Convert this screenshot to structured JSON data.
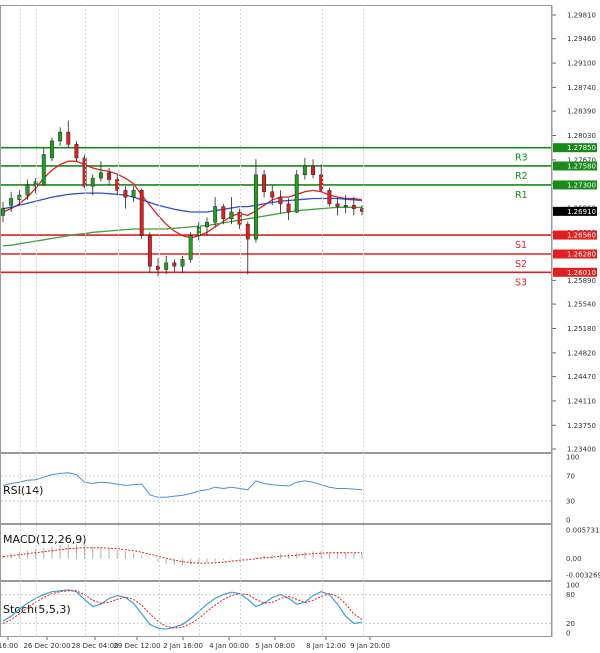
{
  "chart_data": {
    "type": "candlestick",
    "price_panel": {
      "ylim": [
        1.234,
        1.2981
      ],
      "y_ticks": [
        "1.29810",
        "1.29460",
        "1.29100",
        "1.28740",
        "1.28390",
        "1.28030",
        "1.27670",
        "1.27320",
        "1.26960",
        "1.26600",
        "1.26250",
        "1.25890",
        "1.25540",
        "1.25180",
        "1.24820",
        "1.24470",
        "1.24110",
        "1.23750",
        "1.23400"
      ],
      "last_price": "1.26910",
      "last_price_color": "#000000",
      "candle_up_color": "#22a022",
      "candle_down_color": "#e02020",
      "candles": [
        {
          "o": 1.2685,
          "h": 1.2705,
          "l": 1.2675,
          "c": 1.2695
        },
        {
          "o": 1.27,
          "h": 1.272,
          "l": 1.269,
          "c": 1.271
        },
        {
          "o": 1.2708,
          "h": 1.2722,
          "l": 1.27,
          "c": 1.2715
        },
        {
          "o": 1.2715,
          "h": 1.2738,
          "l": 1.2708,
          "c": 1.273
        },
        {
          "o": 1.2728,
          "h": 1.274,
          "l": 1.2718,
          "c": 1.2735
        },
        {
          "o": 1.273,
          "h": 1.2785,
          "l": 1.2728,
          "c": 1.2775
        },
        {
          "o": 1.277,
          "h": 1.28,
          "l": 1.2765,
          "c": 1.2795
        },
        {
          "o": 1.2795,
          "h": 1.2815,
          "l": 1.2788,
          "c": 1.2808
        },
        {
          "o": 1.2808,
          "h": 1.2825,
          "l": 1.2785,
          "c": 1.279
        },
        {
          "o": 1.279,
          "h": 1.2795,
          "l": 1.2765,
          "c": 1.277
        },
        {
          "o": 1.277,
          "h": 1.2775,
          "l": 1.2725,
          "c": 1.2728
        },
        {
          "o": 1.2728,
          "h": 1.2745,
          "l": 1.2715,
          "c": 1.274
        },
        {
          "o": 1.274,
          "h": 1.2765,
          "l": 1.2735,
          "c": 1.2748
        },
        {
          "o": 1.2748,
          "h": 1.2755,
          "l": 1.273,
          "c": 1.2738
        },
        {
          "o": 1.2738,
          "h": 1.2745,
          "l": 1.2715,
          "c": 1.2722
        },
        {
          "o": 1.2722,
          "h": 1.2728,
          "l": 1.2695,
          "c": 1.2712
        },
        {
          "o": 1.2712,
          "h": 1.2728,
          "l": 1.2705,
          "c": 1.2722
        },
        {
          "o": 1.2722,
          "h": 1.2725,
          "l": 1.265,
          "c": 1.2655
        },
        {
          "o": 1.2655,
          "h": 1.266,
          "l": 1.26,
          "c": 1.261
        },
        {
          "o": 1.261,
          "h": 1.2622,
          "l": 1.2595,
          "c": 1.2605
        },
        {
          "o": 1.2605,
          "h": 1.2625,
          "l": 1.2598,
          "c": 1.2615
        },
        {
          "o": 1.2615,
          "h": 1.262,
          "l": 1.2602,
          "c": 1.261
        },
        {
          "o": 1.261,
          "h": 1.2625,
          "l": 1.26,
          "c": 1.262
        },
        {
          "o": 1.262,
          "h": 1.266,
          "l": 1.2615,
          "c": 1.2655
        },
        {
          "o": 1.2655,
          "h": 1.2675,
          "l": 1.2648,
          "c": 1.2668
        },
        {
          "o": 1.2668,
          "h": 1.2682,
          "l": 1.2655,
          "c": 1.2675
        },
        {
          "o": 1.2675,
          "h": 1.2712,
          "l": 1.2668,
          "c": 1.2698
        },
        {
          "o": 1.2698,
          "h": 1.2702,
          "l": 1.2672,
          "c": 1.268
        },
        {
          "o": 1.268,
          "h": 1.2712,
          "l": 1.2672,
          "c": 1.269
        },
        {
          "o": 1.269,
          "h": 1.2695,
          "l": 1.2665,
          "c": 1.2672
        },
        {
          "o": 1.2672,
          "h": 1.2676,
          "l": 1.2598,
          "c": 1.265
        },
        {
          "o": 1.265,
          "h": 1.2768,
          "l": 1.2645,
          "c": 1.2745
        },
        {
          "o": 1.2745,
          "h": 1.2752,
          "l": 1.2712,
          "c": 1.272
        },
        {
          "o": 1.272,
          "h": 1.273,
          "l": 1.27,
          "c": 1.2712
        },
        {
          "o": 1.2712,
          "h": 1.2722,
          "l": 1.2688,
          "c": 1.2702
        },
        {
          "o": 1.2702,
          "h": 1.271,
          "l": 1.2678,
          "c": 1.269
        },
        {
          "o": 1.269,
          "h": 1.2752,
          "l": 1.2688,
          "c": 1.2745
        },
        {
          "o": 1.2745,
          "h": 1.277,
          "l": 1.2738,
          "c": 1.2758
        },
        {
          "o": 1.2758,
          "h": 1.2768,
          "l": 1.274,
          "c": 1.2745
        },
        {
          "o": 1.2745,
          "h": 1.276,
          "l": 1.272,
          "c": 1.2722
        },
        {
          "o": 1.2722,
          "h": 1.2726,
          "l": 1.2698,
          "c": 1.2702
        },
        {
          "o": 1.2702,
          "h": 1.271,
          "l": 1.2685,
          "c": 1.2698
        },
        {
          "o": 1.2698,
          "h": 1.2715,
          "l": 1.2688,
          "c": 1.27
        },
        {
          "o": 1.27,
          "h": 1.2712,
          "l": 1.2685,
          "c": 1.2695
        },
        {
          "o": 1.2695,
          "h": 1.27,
          "l": 1.2685,
          "c": 1.2691
        }
      ],
      "moving_averages": [
        {
          "color": "#e02020",
          "values": [
            1.269,
            1.2695,
            1.2702,
            1.2712,
            1.2725,
            1.274,
            1.2752,
            1.276,
            1.2765,
            1.2765,
            1.276,
            1.2755,
            1.2752,
            1.275,
            1.2746,
            1.274,
            1.2732,
            1.2715,
            1.27,
            1.2685,
            1.2672,
            1.2662,
            1.2655,
            1.2652,
            1.2655,
            1.266,
            1.2668,
            1.2676,
            1.2684,
            1.2688,
            1.2685,
            1.2692,
            1.27,
            1.2708,
            1.2712,
            1.2712,
            1.2716,
            1.272,
            1.2722,
            1.272,
            1.2715,
            1.2712,
            1.271,
            1.271,
            1.2708
          ]
        },
        {
          "color": "#3050c8",
          "values": [
            1.2695,
            1.2697,
            1.27,
            1.2703,
            1.2706,
            1.2709,
            1.2712,
            1.2714,
            1.2716,
            1.2717,
            1.2718,
            1.2718,
            1.2718,
            1.2717,
            1.2716,
            1.2715,
            1.2712,
            1.2708,
            1.2704,
            1.27,
            1.2697,
            1.2694,
            1.2692,
            1.269,
            1.269,
            1.269,
            1.2692,
            1.2694,
            1.2696,
            1.2698,
            1.2698,
            1.27,
            1.2702,
            1.2704,
            1.2706,
            1.2707,
            1.2708,
            1.2709,
            1.271,
            1.271,
            1.271,
            1.271,
            1.2709,
            1.2708,
            1.2707
          ]
        },
        {
          "color": "#40a040",
          "values": [
            1.264,
            1.2641,
            1.2643,
            1.2645,
            1.2647,
            1.2649,
            1.2651,
            1.2653,
            1.2655,
            1.2657,
            1.2658,
            1.266,
            1.2661,
            1.2662,
            1.2663,
            1.2664,
            1.2665,
            1.2665,
            1.2665,
            1.2665,
            1.2665,
            1.2666,
            1.2667,
            1.2668,
            1.2669,
            1.267,
            1.2672,
            1.2674,
            1.2676,
            1.2678,
            1.268,
            1.2682,
            1.2684,
            1.2686,
            1.2688,
            1.269,
            1.2692,
            1.2693,
            1.2694,
            1.2695,
            1.2696,
            1.2697,
            1.2697,
            1.2697,
            1.2697
          ]
        }
      ],
      "levels": [
        {
          "name": "R3",
          "price": "1.27850",
          "value": 1.2785,
          "color": "#1a8a1a"
        },
        {
          "name": "R2",
          "price": "1.27580",
          "value": 1.2758,
          "color": "#1a8a1a"
        },
        {
          "name": "R1",
          "price": "1.27300",
          "value": 1.273,
          "color": "#1a8a1a"
        },
        {
          "name": "S1",
          "price": "1.26560",
          "value": 1.2656,
          "color": "#e02020"
        },
        {
          "name": "S2",
          "price": "1.26280",
          "value": 1.2628,
          "color": "#e02020"
        },
        {
          "name": "S3",
          "price": "1.26010",
          "value": 1.2601,
          "color": "#e02020"
        }
      ]
    },
    "rsi_panel": {
      "label": "RSI(14)",
      "ylim": [
        0,
        100
      ],
      "y_ticks": [
        "100",
        "70",
        "30",
        "0"
      ],
      "line_color": "#4a90d9",
      "values": [
        55,
        58,
        60,
        63,
        64,
        68,
        72,
        74,
        75,
        72,
        60,
        58,
        60,
        59,
        57,
        55,
        56,
        57,
        40,
        36,
        36,
        38,
        39,
        42,
        46,
        48,
        52,
        50,
        52,
        50,
        48,
        62,
        58,
        56,
        55,
        54,
        60,
        62,
        60,
        56,
        52,
        50,
        50,
        49,
        48
      ]
    },
    "macd_panel": {
      "label": "MACD(12,26,9)",
      "ylim": [
        -0.003269,
        0.005731
      ],
      "y_ticks": [
        "0.005731",
        "0.00",
        "-0.003269"
      ],
      "histogram_color": "#b0b0b0",
      "signal_color": "#e02020",
      "histogram": [
        0.0008,
        0.001,
        0.0013,
        0.0016,
        0.0019,
        0.0022,
        0.0025,
        0.0027,
        0.0028,
        0.0028,
        0.0026,
        0.0024,
        0.0022,
        0.002,
        0.0018,
        0.0015,
        0.0012,
        0.0006,
        -0.0001,
        -0.0006,
        -0.001,
        -0.0012,
        -0.0013,
        -0.0012,
        -0.001,
        -0.0008,
        -0.0005,
        -0.0003,
        -0.0001,
        0.0,
        0.0001,
        0.0004,
        0.0006,
        0.0008,
        0.0009,
        0.001,
        0.0012,
        0.0014,
        0.0015,
        0.0015,
        0.0014,
        0.0013,
        0.0012,
        0.0011,
        0.001
      ],
      "signal": [
        0.0004,
        0.0006,
        0.0008,
        0.001,
        0.0012,
        0.0014,
        0.0016,
        0.0018,
        0.002,
        0.0021,
        0.0022,
        0.0022,
        0.0022,
        0.0021,
        0.002,
        0.0018,
        0.0016,
        0.0013,
        0.0009,
        0.0005,
        0.0001,
        -0.0003,
        -0.0006,
        -0.0008,
        -0.0009,
        -0.0009,
        -0.0008,
        -0.0007,
        -0.0005,
        -0.0003,
        -0.0002,
        0.0,
        0.0002,
        0.0003,
        0.0005,
        0.0006,
        0.0007,
        0.0009,
        0.001,
        0.0011,
        0.0012,
        0.0012,
        0.0012,
        0.0012,
        0.0012
      ]
    },
    "stoch_panel": {
      "label": "Stoch(5,5,3)",
      "ylim": [
        0,
        100
      ],
      "y_ticks": [
        "100",
        "80",
        "20",
        "0"
      ],
      "k_color": "#3aa0d0",
      "d_color": "#e02020",
      "k": [
        25,
        35,
        50,
        62,
        72,
        80,
        86,
        88,
        90,
        86,
        70,
        55,
        60,
        72,
        78,
        74,
        62,
        40,
        18,
        10,
        8,
        12,
        18,
        30,
        45,
        60,
        72,
        80,
        85,
        82,
        70,
        55,
        62,
        74,
        80,
        72,
        60,
        64,
        78,
        86,
        80,
        60,
        35,
        20,
        22
      ],
      "d": [
        20,
        28,
        40,
        52,
        64,
        74,
        82,
        86,
        88,
        88,
        80,
        68,
        62,
        64,
        70,
        75,
        70,
        58,
        40,
        24,
        14,
        10,
        12,
        20,
        30,
        45,
        58,
        70,
        78,
        82,
        80,
        70,
        62,
        64,
        72,
        76,
        70,
        64,
        68,
        76,
        82,
        76,
        60,
        40,
        28
      ]
    },
    "x_ticks": [
      "16:00",
      "26 Dec 20:00",
      "28 Dec 04:00",
      "29 Dec 12:00",
      "2 Jan 16:00",
      "4 Jan 00:00",
      "5 Jan 08:00",
      "8 Jan 12:00",
      "9 Jan 20:00"
    ]
  }
}
